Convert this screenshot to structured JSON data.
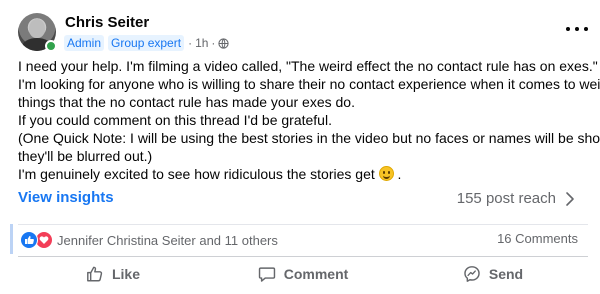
{
  "post": {
    "author": "Chris Seiter",
    "badges": [
      "Admin",
      "Group expert"
    ],
    "time": "1h",
    "separator": "·",
    "privacy_icon": "globe-icon",
    "body_lines": [
      "I need your help. I'm filming a video called, \"The weird effect the no contact rule has on exes.\"",
      "I'm looking for anyone who is willing to share their no contact experience when it comes to weird",
      "things that the no contact rule has made your exes do.",
      "If you could comment on this thread I'd be grateful.",
      "(One Quick Note: I will be using the best stories in the video but no faces or names will be shown,",
      "they'll be blurred out.)"
    ],
    "last_line_text": "I'm genuinely excited to see how ridiculous the stories get",
    "last_line_end": ".",
    "last_line_emoji": "smiling-face-emoji"
  },
  "insights": {
    "link_label": "View insights",
    "reach_label": "155 post reach"
  },
  "stats": {
    "reaction_icons": [
      "like-reaction-icon",
      "love-reaction-icon"
    ],
    "reaction_names": "Jennifer Christina Seiter and 11 others",
    "comments": "16 Comments"
  },
  "actions": {
    "like": "Like",
    "comment": "Comment",
    "send": "Send"
  },
  "colors": {
    "accent": "#1877f2",
    "secondary_text": "#65676b",
    "love": "#f33e58",
    "online": "#31a24c"
  }
}
